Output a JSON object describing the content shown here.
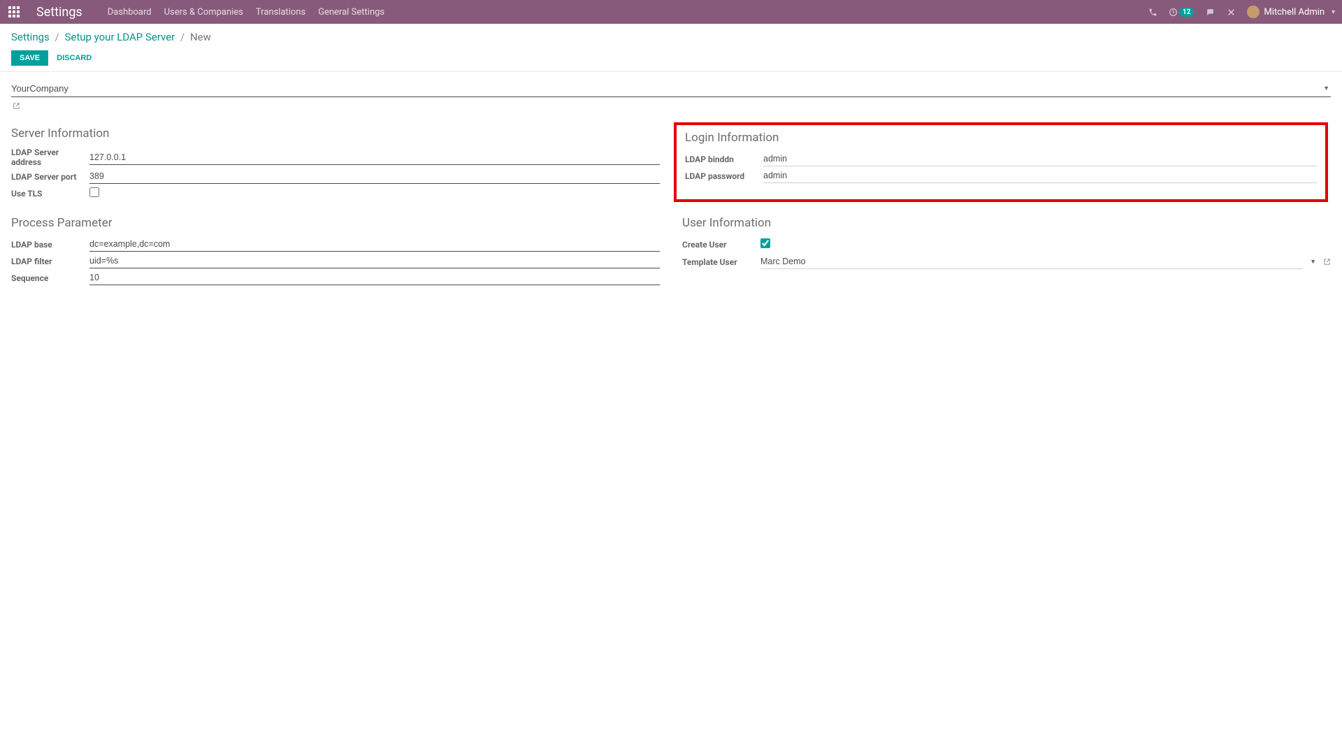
{
  "navbar": {
    "app_title": "Settings",
    "menu": [
      "Dashboard",
      "Users & Companies",
      "Translations",
      "General Settings"
    ],
    "activity_badge": "12",
    "user_name": "Mitchell Admin"
  },
  "breadcrumb": {
    "root": "Settings",
    "mid": "Setup your LDAP Server",
    "current": "New"
  },
  "buttons": {
    "save": "SAVE",
    "discard": "DISCARD"
  },
  "form": {
    "company": "YourCompany",
    "server_info": {
      "title": "Server Information",
      "address_label": "LDAP Server address",
      "address": "127.0.0.1",
      "port_label": "LDAP Server port",
      "port": "389",
      "tls_label": "Use TLS",
      "tls": false
    },
    "login_info": {
      "title": "Login Information",
      "binddn_label": "LDAP binddn",
      "binddn": "admin",
      "password_label": "LDAP password",
      "password": "admin"
    },
    "process_param": {
      "title": "Process Parameter",
      "base_label": "LDAP base",
      "base": "dc=example,dc=com",
      "filter_label": "LDAP filter",
      "filter": "uid=%s",
      "sequence_label": "Sequence",
      "sequence": "10"
    },
    "user_info": {
      "title": "User Information",
      "create_user_label": "Create User",
      "create_user": true,
      "template_user_label": "Template User",
      "template_user": "Marc Demo"
    }
  }
}
